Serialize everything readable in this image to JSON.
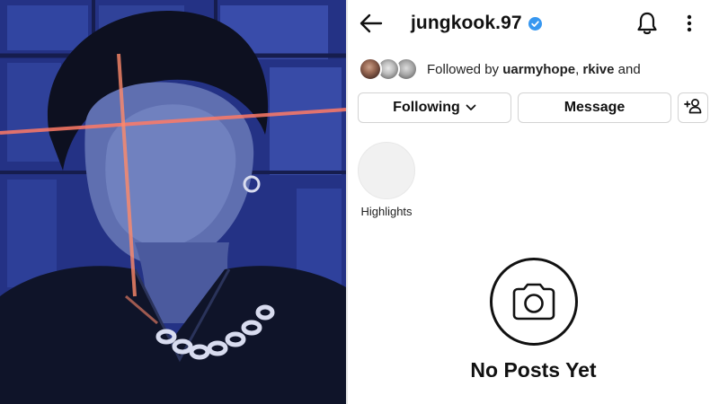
{
  "photo": {
    "subject": "profile-photo"
  },
  "header": {
    "username": "jungkook.97",
    "verified": true
  },
  "icons": {
    "back": "back-arrow-icon",
    "verified": "verified-badge-icon",
    "bell": "bell-icon",
    "more": "more-vertical-icon",
    "chevron": "chevron-down-icon",
    "add_user": "add-user-icon",
    "camera": "camera-icon"
  },
  "followed_by": {
    "prefix": "Followed by ",
    "user1": "uarmyhope",
    "separator": ", ",
    "user2": "rkive",
    "suffix": " and"
  },
  "buttons": {
    "following": "Following",
    "message": "Message"
  },
  "highlights": [
    {
      "label": "Highlights"
    }
  ],
  "empty_state": {
    "title": "No Posts Yet"
  },
  "colors": {
    "verified": "#3797f0",
    "button_border": "#d3d3d3",
    "highlight_bg": "#f1f1f1"
  }
}
